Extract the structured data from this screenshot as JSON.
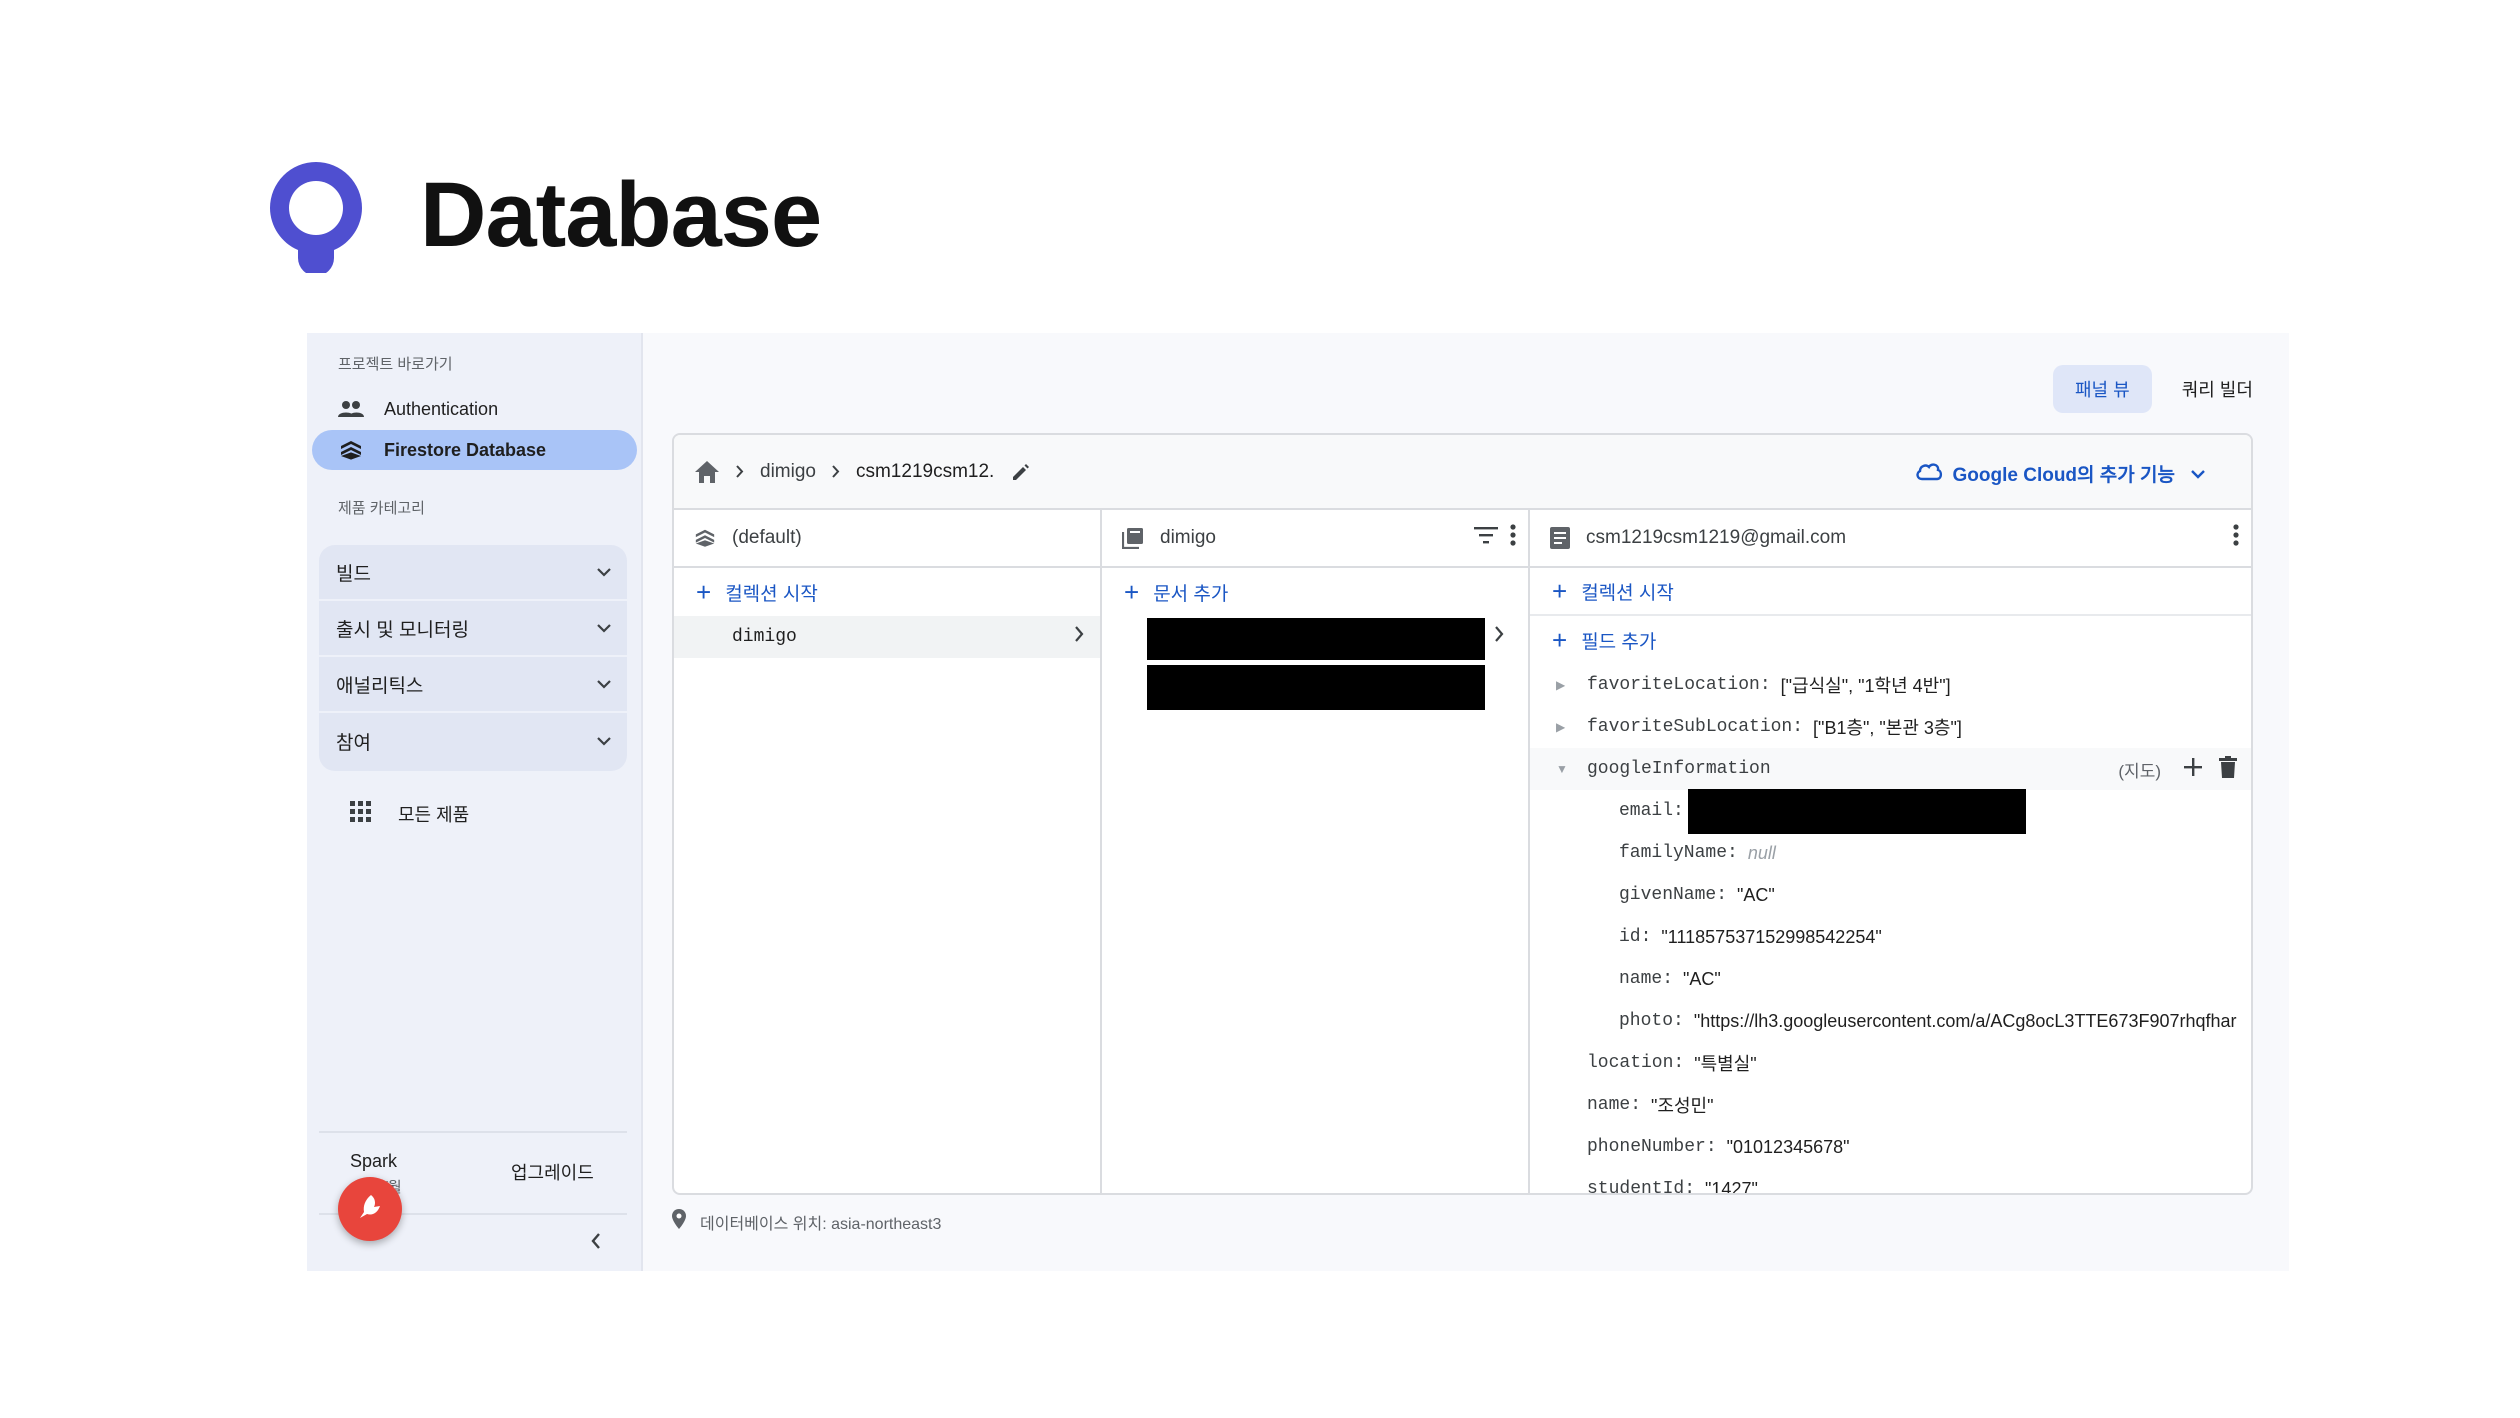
{
  "slide": {
    "title": "Database",
    "logo": "location-pin-logo",
    "logo_color": "#4f4fd0"
  },
  "sidebar": {
    "shortcuts_caption": "프로젝트 바로가기",
    "shortcuts": [
      {
        "label": "Authentication",
        "icon": "people-icon"
      },
      {
        "label": "Firestore Database",
        "icon": "firestore-icon",
        "active": true
      }
    ],
    "category_caption": "제품 카테고리",
    "categories": [
      {
        "label": "빌드"
      },
      {
        "label": "출시 및 모니터링"
      },
      {
        "label": "애널리틱스"
      },
      {
        "label": "참여"
      }
    ],
    "all_products": "모든 제품",
    "plan_name": "Spark",
    "plan_sub": "$0/월",
    "upgrade_label": "업그레이드",
    "active_color": "#a9c4f7",
    "fab_color": "#e8453c"
  },
  "view_toggle": {
    "panel_view": "패널 뷰",
    "query_builder": "쿼리 빌더"
  },
  "breadcrumb": {
    "items": [
      "dimigo",
      "csm1219csm12."
    ],
    "google_cloud": "Google Cloud의 추가 기능"
  },
  "columns": {
    "root": {
      "title": "(default)",
      "action": "컬렉션 시작",
      "selected_collection": "dimigo"
    },
    "collection": {
      "title": "dimigo",
      "action": "문서 추가"
    },
    "document": {
      "title": "csm1219csm1219@gmail.com",
      "action_collection": "컬렉션 시작",
      "action_field": "필드 추가",
      "fields": {
        "favoriteLocation": {
          "key": "favoriteLocation:",
          "value": "[\"급식실\", \"1학년 4반\"]"
        },
        "favoriteSubLocation": {
          "key": "favoriteSubLocation:",
          "value": "[\"B1층\", \"본관 3층\"]"
        },
        "googleInformation": {
          "key": "googleInformation",
          "type": "(지도)"
        },
        "email": {
          "key": "email:"
        },
        "familyName": {
          "key": "familyName:",
          "value": "null"
        },
        "givenName": {
          "key": "givenName:",
          "value": "\"AC\""
        },
        "id": {
          "key": "id:",
          "value": "\"111857537152998542254\""
        },
        "name_inner": {
          "key": "name:",
          "value": "\"AC\""
        },
        "photo": {
          "key": "photo:",
          "value": "\"https://lh3.googleusercontent.com/a/ACg8ocL3TTE673F907rhqfhar"
        },
        "location": {
          "key": "location:",
          "value": "\"특별실\""
        },
        "name": {
          "key": "name:",
          "value": "\"조성민\""
        },
        "phoneNumber": {
          "key": "phoneNumber:",
          "value": "\"01012345678\""
        },
        "studentId": {
          "key": "studentId:",
          "value": "\"1427\""
        }
      }
    }
  },
  "footer": {
    "location": "데이터베이스 위치: asia-northeast3"
  },
  "colors": {
    "link": "#1a56c4",
    "redaction": "#000000"
  }
}
